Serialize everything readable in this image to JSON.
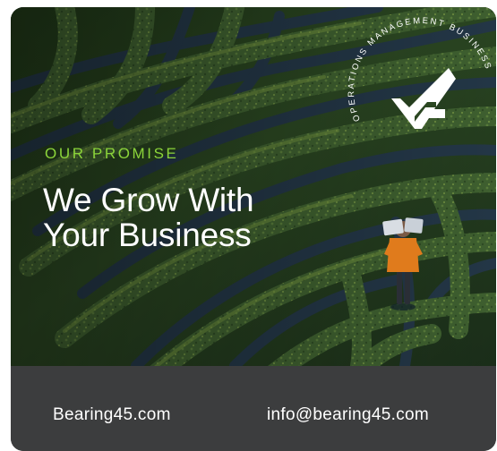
{
  "hero": {
    "eyebrow": "OUR PROMISE",
    "headline_line1": "We Grow With",
    "headline_line2": "Your Business"
  },
  "logo": {
    "ring_text": "OPERATIONS MANAGEMENT BUSINESS",
    "colors": {
      "mark": "#ffffff"
    }
  },
  "footer": {
    "website": "Bearing45.com",
    "email": "info@bearing45.com"
  },
  "colors": {
    "accent": "#8bd43a",
    "headline": "#ffffff",
    "footer_bg": "#3c3d3e",
    "hedge_dark": "#1f3419",
    "hedge_mid": "#3f6230",
    "hedge_light": "#6f8f3c",
    "path": "#233646"
  }
}
